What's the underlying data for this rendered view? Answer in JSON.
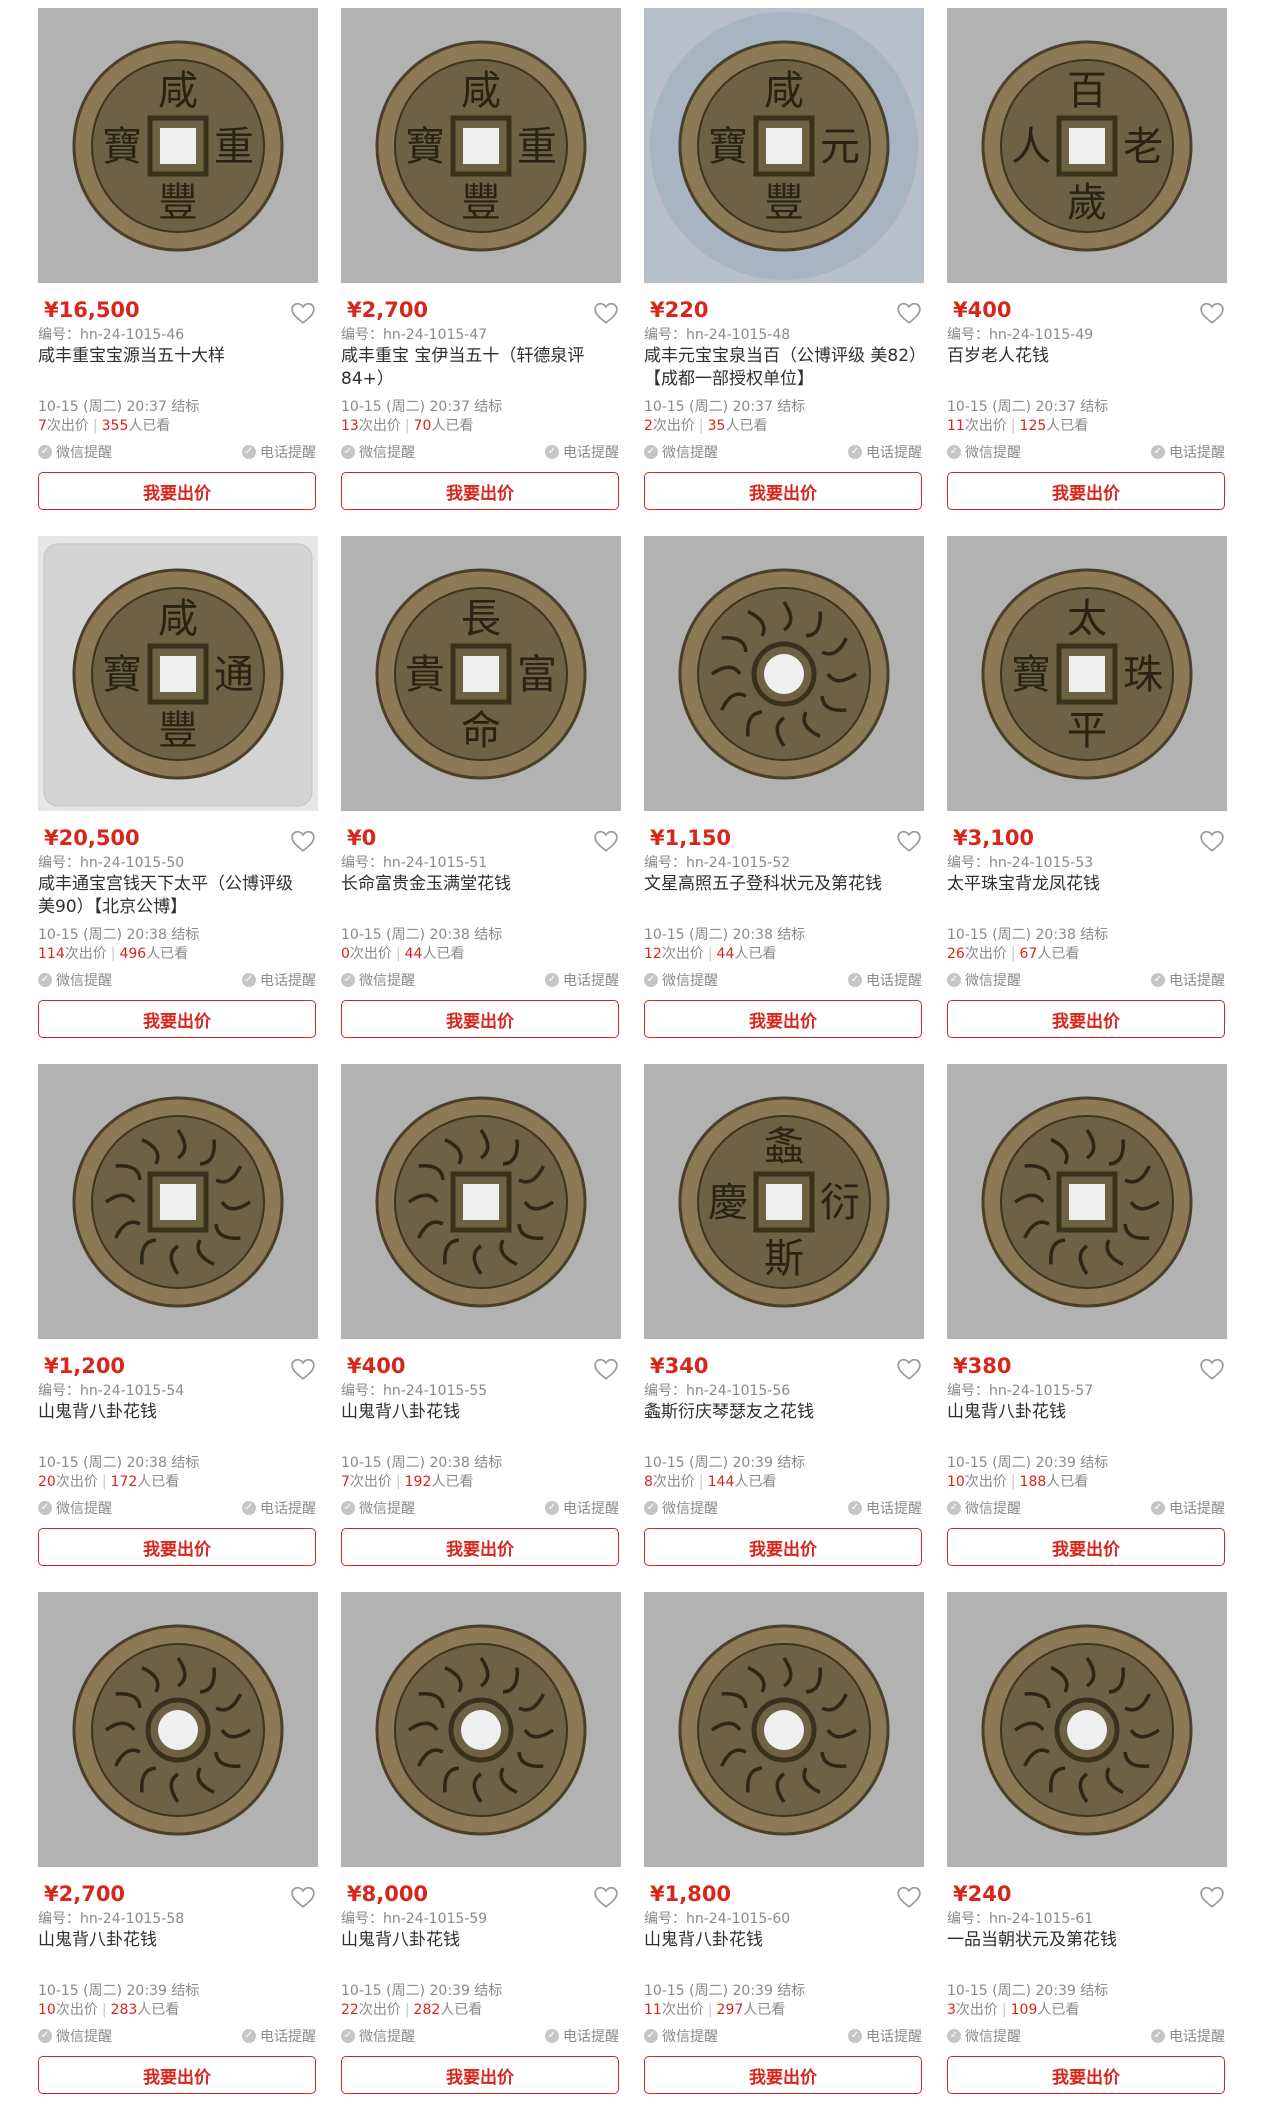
{
  "colors": {
    "price": "#d9261c",
    "muted": "#8a8a8a",
    "title": "#2f2f2f",
    "bronze": "#6b5b3a"
  },
  "labels": {
    "bid": "我要出价",
    "wechat": "微信提醒",
    "phone": "电话提醒",
    "bids_suffix": "次出价",
    "views_suffix": "人已看",
    "separator": "|"
  },
  "items": [
    {
      "price": "¥16,500",
      "code": "编号：hn-24-1015-46",
      "title": "咸丰重宝宝源当五十大样",
      "end": "10-15 (周二) 20:37 结标",
      "bids": "7",
      "views": "355",
      "chars": [
        "咸",
        "寶",
        "重",
        "豐"
      ],
      "hole": "square",
      "bg": "plain"
    },
    {
      "price": "¥2,700",
      "code": "编号：hn-24-1015-47",
      "title": "咸丰重宝 宝伊当五十（轩德泉评84+）",
      "end": "10-15 (周二) 20:37 结标",
      "bids": "13",
      "views": "70",
      "chars": [
        "咸",
        "寶",
        "重",
        "豐"
      ],
      "hole": "square",
      "bg": "plain"
    },
    {
      "price": "¥220",
      "code": "编号：hn-24-1015-48",
      "title": "咸丰元宝宝泉当百（公博评级 美82）【成都一部授权单位】",
      "end": "10-15 (周二) 20:37 结标",
      "bids": "2",
      "views": "35",
      "chars": [
        "咸",
        "寶",
        "元",
        "豐"
      ],
      "hole": "square",
      "bg": "slab"
    },
    {
      "price": "¥400",
      "code": "编号：hn-24-1015-49",
      "title": "百岁老人花钱",
      "end": "10-15 (周二) 20:37 结标",
      "bids": "11",
      "views": "125",
      "chars": [
        "百",
        "人",
        "老",
        "歲"
      ],
      "hole": "square",
      "bg": "plain"
    },
    {
      "price": "¥20,500",
      "code": "编号：hn-24-1015-50",
      "title": "咸丰通宝宫钱天下太平（公博评级 美90）【北京公博】",
      "end": "10-15 (周二) 20:38 结标",
      "bids": "114",
      "views": "496",
      "chars": [
        "咸",
        "寶",
        "通",
        "豐"
      ],
      "hole": "square",
      "bg": "light"
    },
    {
      "price": "¥0",
      "code": "编号：hn-24-1015-51",
      "title": "长命富贵金玉满堂花钱",
      "end": "10-15 (周二) 20:38 结标",
      "bids": "0",
      "views": "44",
      "chars": [
        "長",
        "貴",
        "富",
        "命"
      ],
      "hole": "square",
      "bg": "plain"
    },
    {
      "price": "¥1,150",
      "code": "编号：hn-24-1015-52",
      "title": "文星高照五子登科状元及第花钱",
      "end": "10-15 (周二) 20:38 结标",
      "bids": "12",
      "views": "44",
      "chars": [],
      "hole": "round",
      "bg": "plain"
    },
    {
      "price": "¥3,100",
      "code": "编号：hn-24-1015-53",
      "title": "太平珠宝背龙凤花钱",
      "end": "10-15 (周二) 20:38 结标",
      "bids": "26",
      "views": "67",
      "chars": [
        "太",
        "寶",
        "珠",
        "平"
      ],
      "hole": "square",
      "bg": "plain"
    },
    {
      "price": "¥1,200",
      "code": "编号：hn-24-1015-54",
      "title": "山鬼背八卦花钱",
      "end": "10-15 (周二) 20:38 结标",
      "bids": "20",
      "views": "172",
      "chars": [],
      "hole": "square",
      "bg": "plain"
    },
    {
      "price": "¥400",
      "code": "编号：hn-24-1015-55",
      "title": "山鬼背八卦花钱",
      "end": "10-15 (周二) 20:38 结标",
      "bids": "7",
      "views": "192",
      "chars": [],
      "hole": "square",
      "bg": "plain"
    },
    {
      "price": "¥340",
      "code": "编号：hn-24-1015-56",
      "title": "螽斯衍庆琴瑟友之花钱",
      "end": "10-15 (周二) 20:39 结标",
      "bids": "8",
      "views": "144",
      "chars": [
        "螽",
        "慶",
        "衍",
        "斯"
      ],
      "hole": "square",
      "bg": "plain"
    },
    {
      "price": "¥380",
      "code": "编号：hn-24-1015-57",
      "title": "山鬼背八卦花钱",
      "end": "10-15 (周二) 20:39 结标",
      "bids": "10",
      "views": "188",
      "chars": [],
      "hole": "square",
      "bg": "plain"
    },
    {
      "price": "¥2,700",
      "code": "编号：hn-24-1015-58",
      "title": "山鬼背八卦花钱",
      "end": "10-15 (周二) 20:39 结标",
      "bids": "10",
      "views": "283",
      "chars": [],
      "hole": "round",
      "bg": "plain"
    },
    {
      "price": "¥8,000",
      "code": "编号：hn-24-1015-59",
      "title": "山鬼背八卦花钱",
      "end": "10-15 (周二) 20:39 结标",
      "bids": "22",
      "views": "282",
      "chars": [],
      "hole": "round",
      "bg": "plain"
    },
    {
      "price": "¥1,800",
      "code": "编号：hn-24-1015-60",
      "title": "山鬼背八卦花钱",
      "end": "10-15 (周二) 20:39 结标",
      "bids": "11",
      "views": "297",
      "chars": [],
      "hole": "round",
      "bg": "plain"
    },
    {
      "price": "¥240",
      "code": "编号：hn-24-1015-61",
      "title": "一品当朝状元及第花钱",
      "end": "10-15 (周二) 20:39 结标",
      "bids": "3",
      "views": "109",
      "chars": [],
      "hole": "round",
      "bg": "plain"
    }
  ]
}
